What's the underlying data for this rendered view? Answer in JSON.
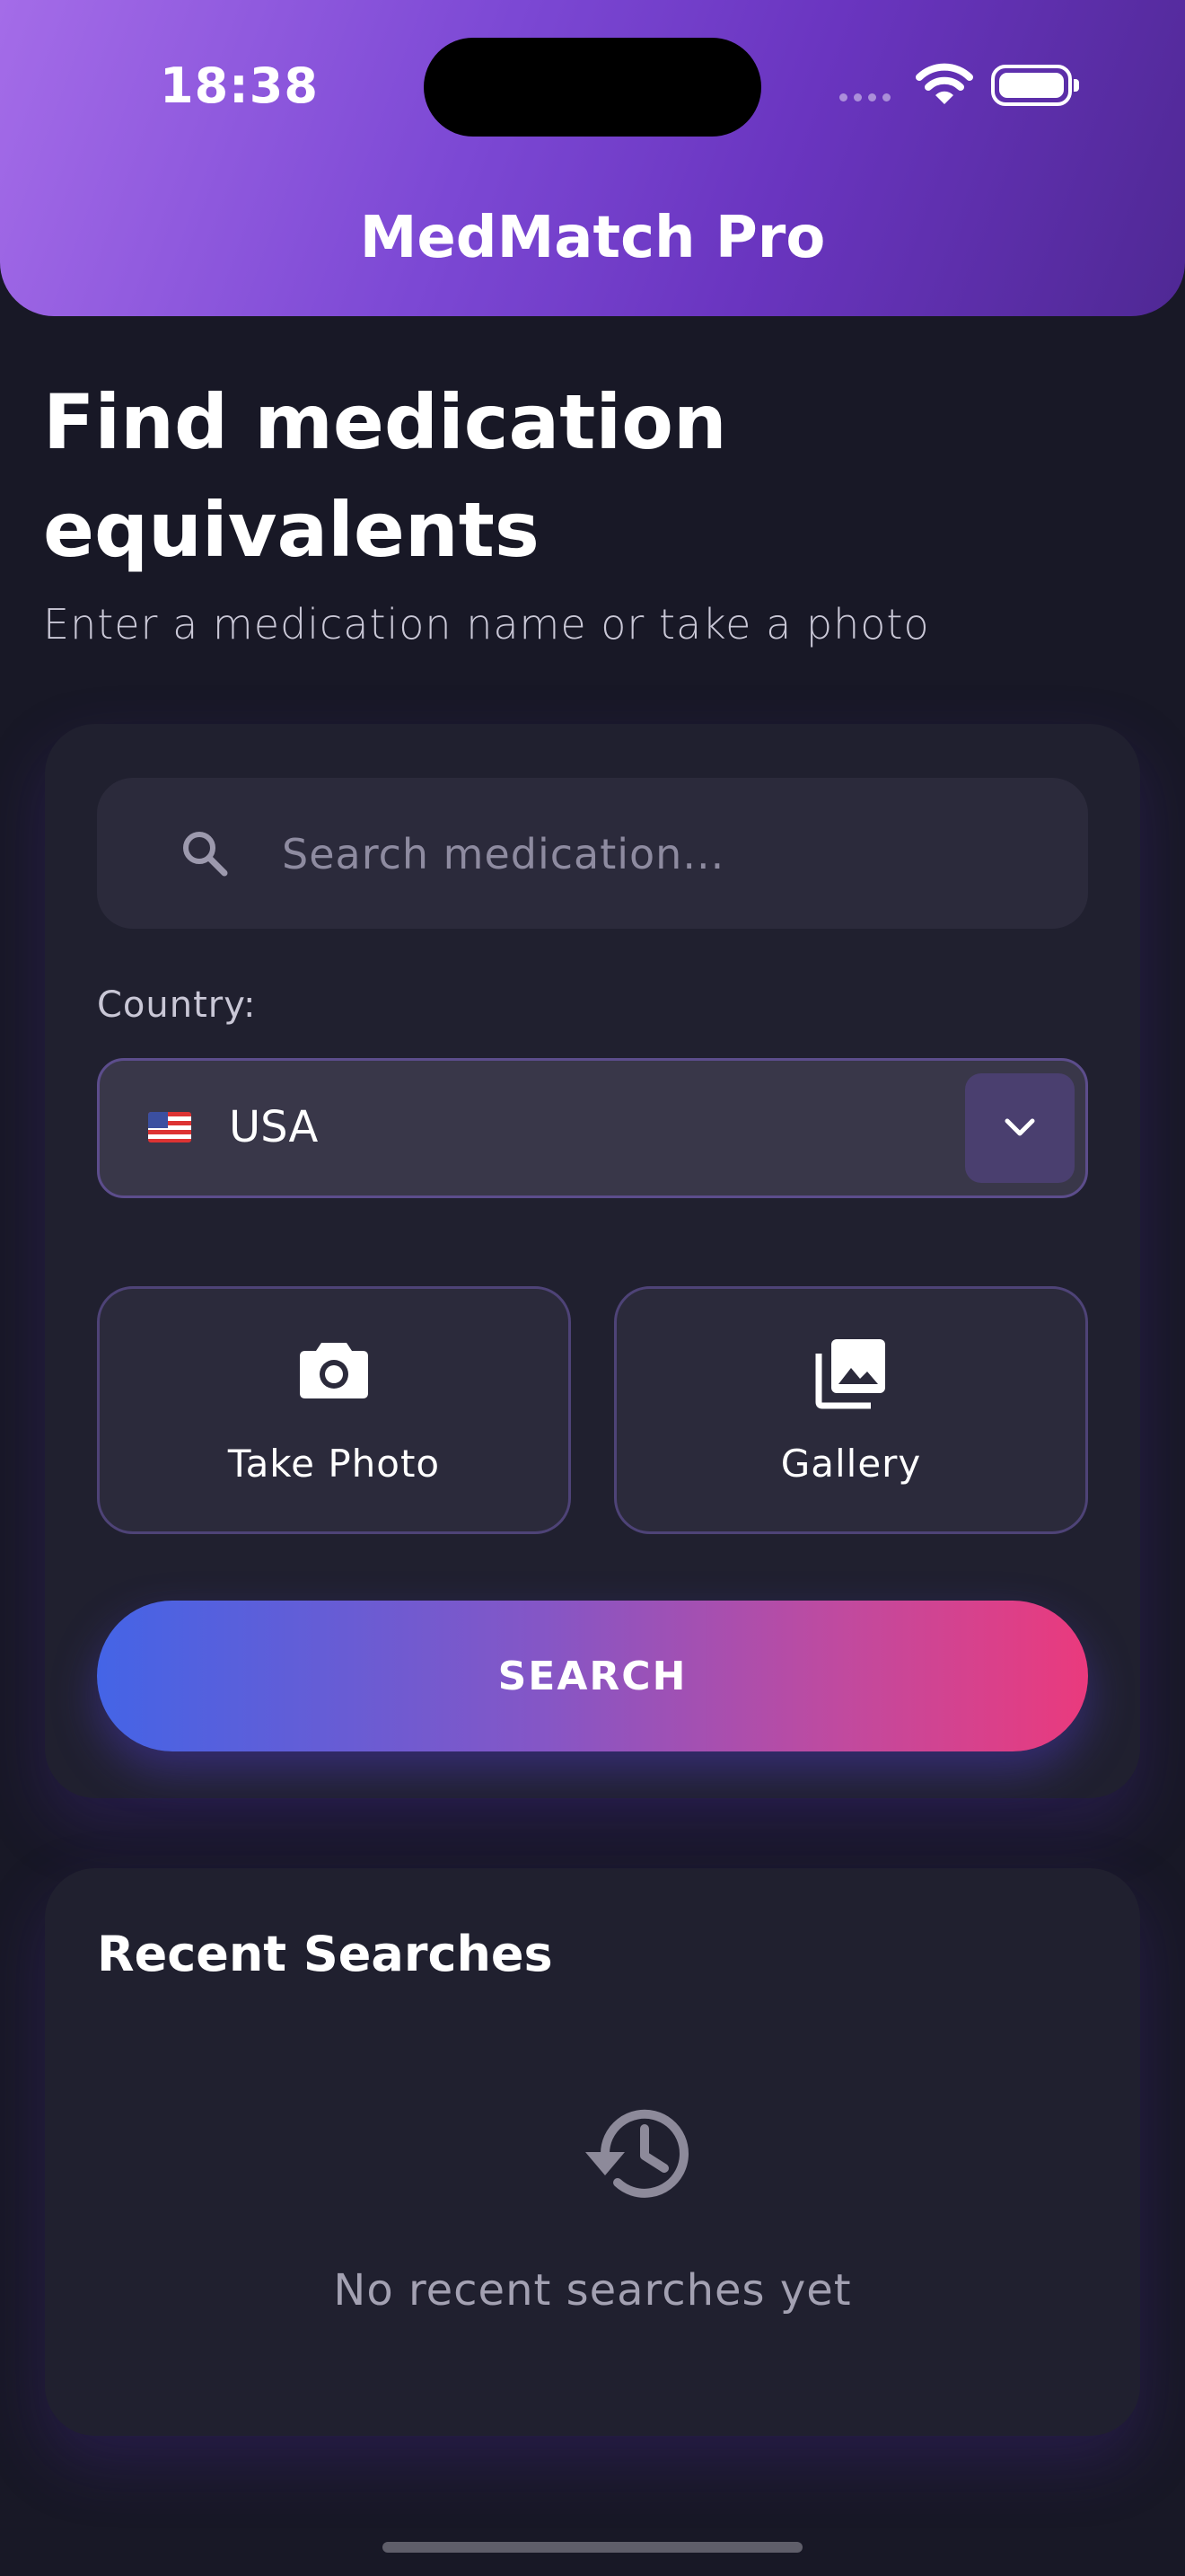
{
  "status_bar": {
    "time": "18:38"
  },
  "header": {
    "app_title": "MedMatch Pro"
  },
  "main": {
    "title": "Find medication equivalents",
    "subtitle": "Enter a medication name or take a photo"
  },
  "search": {
    "value": "",
    "placeholder": "Search medication...",
    "icon": "search-icon"
  },
  "country": {
    "label": "Country:",
    "selected": "USA",
    "flag": "us-flag-icon"
  },
  "actions": {
    "take_photo": {
      "label": "Take Photo",
      "icon": "camera-icon"
    },
    "gallery": {
      "label": "Gallery",
      "icon": "gallery-icon"
    }
  },
  "search_button": {
    "label": "SEARCH"
  },
  "recent": {
    "title": "Recent Searches",
    "icon": "history-icon",
    "empty_text": "No recent searches yet"
  },
  "colors": {
    "background": "#181826",
    "header_gradient_start": "#a46ce8",
    "header_gradient_end": "#4f2894",
    "card": "#20202f",
    "button_gradient_start": "#4464e6",
    "button_gradient_end": "#ea3a7d"
  }
}
